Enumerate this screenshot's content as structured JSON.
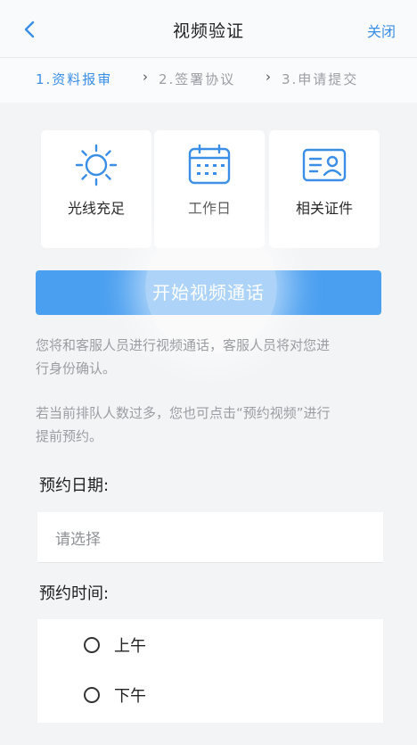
{
  "header": {
    "back_icon": "chevron-left-icon",
    "title": "视频验证",
    "close_label": "关闭",
    "accent_color": "#3a8ee6"
  },
  "steps": [
    {
      "label": "1.资料报审",
      "active": true
    },
    {
      "label": "2.签署协议",
      "active": false
    },
    {
      "label": "3.申请提交",
      "active": false
    }
  ],
  "step_separator": "›",
  "tips": [
    {
      "icon": "sun-icon",
      "label": "光线充足"
    },
    {
      "icon": "calendar-icon",
      "label": "工作日"
    },
    {
      "icon": "id-card-icon",
      "label": "相关证件"
    }
  ],
  "start_button": {
    "label": "开始视频通话",
    "color": "#4a9ff0"
  },
  "description": {
    "line1a": "您将和客服人员进行视频通话，客服人员将对您进",
    "line1b": "行身份确认。",
    "line2a": "若当前排队人数过多，您也可点击“预约视频”进行",
    "line2b": "提前预约。"
  },
  "appointment": {
    "date_label": "预约日期:",
    "date_placeholder": "请选择",
    "time_label": "预约时间:",
    "time_options": [
      "上午",
      "下午"
    ]
  }
}
